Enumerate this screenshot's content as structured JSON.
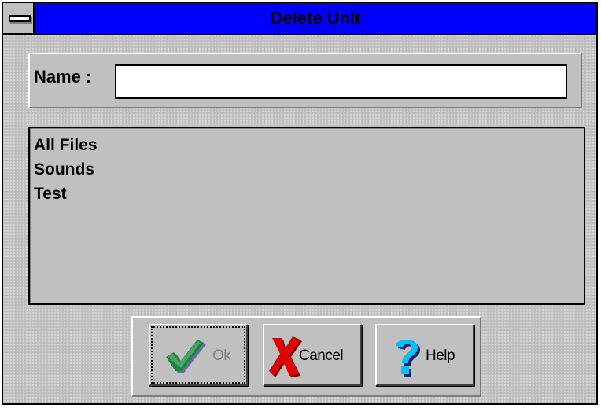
{
  "window": {
    "title": "Delete Unit"
  },
  "name_field": {
    "label": "Name :",
    "value": ""
  },
  "units_list": {
    "items": [
      "All Files",
      "Sounds",
      "Test"
    ]
  },
  "buttons": {
    "ok": {
      "label": "Ok",
      "icon": "checkmark-icon",
      "enabled": false
    },
    "cancel": {
      "label": "Cancel",
      "icon": "x-icon"
    },
    "help": {
      "label": "Help",
      "icon": "question-mark-icon"
    }
  },
  "colors": {
    "title_bar": "#0000ff",
    "face": "#c0c0c0",
    "check_green": "#208040",
    "x_red": "#e00000",
    "help_cyan": "#00c0ff"
  }
}
